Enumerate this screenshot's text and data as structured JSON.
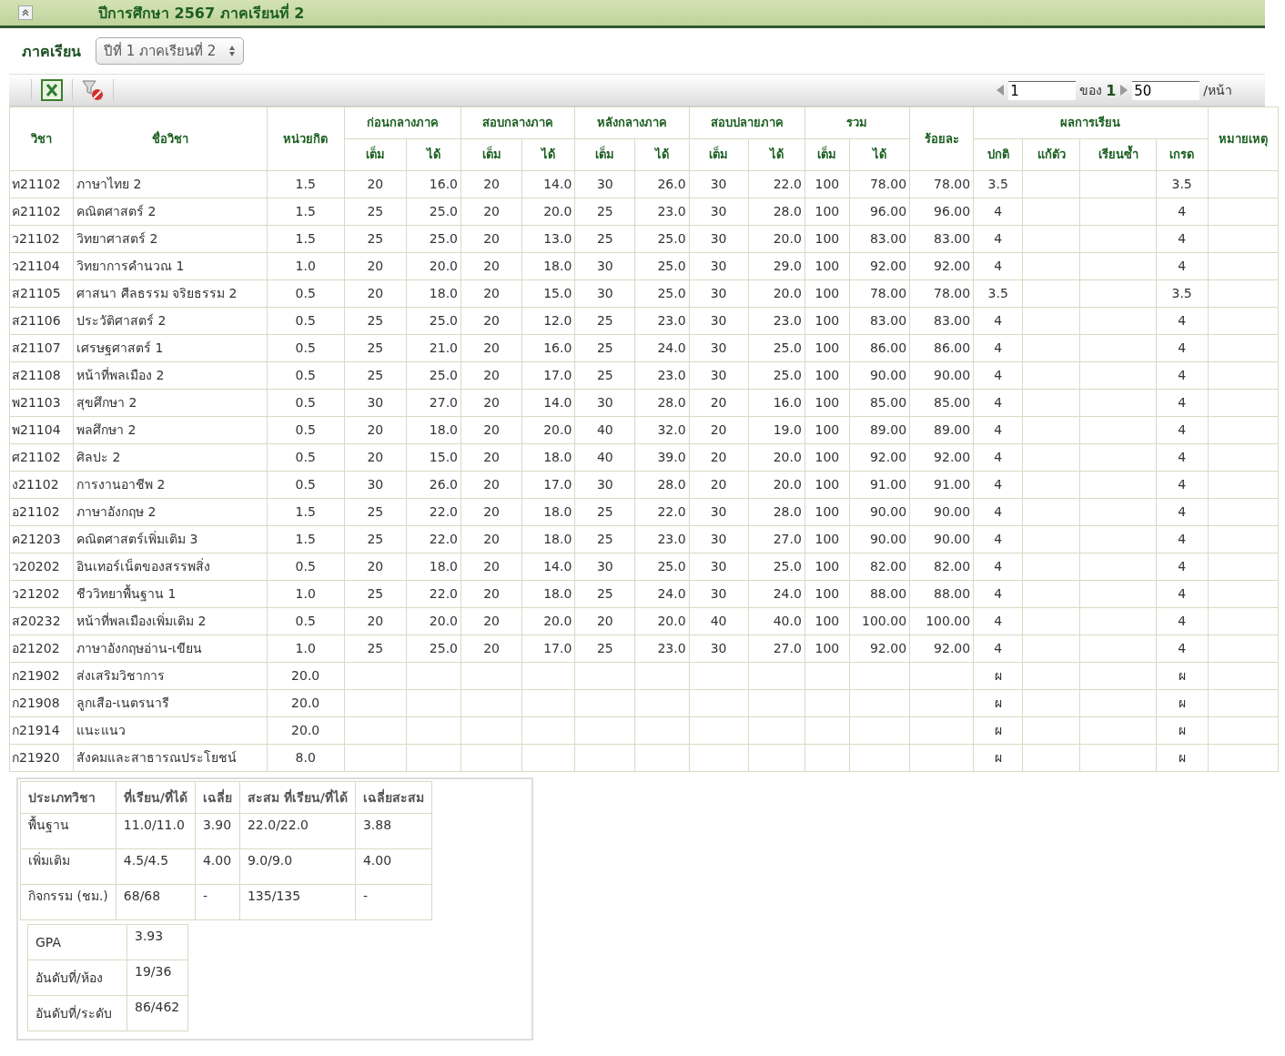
{
  "panel": {
    "title": "ปีการศึกษา 2567 ภาคเรียนที่ 2",
    "collapsed": false
  },
  "term_filter": {
    "label": "ภาคเรียน",
    "value": "ปีที่ 1 ภาคเรียนที่ 2"
  },
  "pager": {
    "page": "1",
    "of_label": "ของ",
    "total_pages": "1",
    "page_size": "50",
    "per_page_label": "/หน้า"
  },
  "table": {
    "columns": {
      "code": "วิชา",
      "name": "ชื่อวิชา",
      "credits": "หน่วยกิต",
      "groups": [
        {
          "label": "ก่อนกลางภาค",
          "full": "เต็ม",
          "got": "ได้"
        },
        {
          "label": "สอบกลางภาค",
          "full": "เต็ม",
          "got": "ได้"
        },
        {
          "label": "หลังกลางภาค",
          "full": "เต็ม",
          "got": "ได้"
        },
        {
          "label": "สอบปลายภาค",
          "full": "เต็ม",
          "got": "ได้"
        },
        {
          "label": "รวม",
          "full": "เต็ม",
          "got": "ได้"
        }
      ],
      "percent": "ร้อยละ",
      "result": "ผลการเรียน",
      "result_sub": [
        "ปกติ",
        "แก้ตัว",
        "เรียนซ้ำ",
        "เกรด"
      ],
      "note": "หมายเหตุ"
    },
    "rows": [
      {
        "code": "ท21102",
        "name": "ภาษาไทย 2",
        "credits": "1.5",
        "scores": [
          "20",
          "16.0",
          "20",
          "14.0",
          "30",
          "26.0",
          "30",
          "22.0",
          "100",
          "78.00"
        ],
        "percent": "78.00",
        "normal": "3.5",
        "grade": "3.5"
      },
      {
        "code": "ค21102",
        "name": "คณิตศาสตร์ 2",
        "credits": "1.5",
        "scores": [
          "25",
          "25.0",
          "20",
          "20.0",
          "25",
          "23.0",
          "30",
          "28.0",
          "100",
          "96.00"
        ],
        "percent": "96.00",
        "normal": "4",
        "grade": "4"
      },
      {
        "code": "ว21102",
        "name": "วิทยาศาสตร์ 2",
        "credits": "1.5",
        "scores": [
          "25",
          "25.0",
          "20",
          "13.0",
          "25",
          "25.0",
          "30",
          "20.0",
          "100",
          "83.00"
        ],
        "percent": "83.00",
        "normal": "4",
        "grade": "4"
      },
      {
        "code": "ว21104",
        "name": "วิทยาการคำนวณ 1",
        "credits": "1.0",
        "scores": [
          "20",
          "20.0",
          "20",
          "18.0",
          "30",
          "25.0",
          "30",
          "29.0",
          "100",
          "92.00"
        ],
        "percent": "92.00",
        "normal": "4",
        "grade": "4"
      },
      {
        "code": "ส21105",
        "name": "ศาสนา ศีลธรรม จริยธรรม 2",
        "credits": "0.5",
        "scores": [
          "20",
          "18.0",
          "20",
          "15.0",
          "30",
          "25.0",
          "30",
          "20.0",
          "100",
          "78.00"
        ],
        "percent": "78.00",
        "normal": "3.5",
        "grade": "3.5"
      },
      {
        "code": "ส21106",
        "name": "ประวัติศาสตร์ 2",
        "credits": "0.5",
        "scores": [
          "25",
          "25.0",
          "20",
          "12.0",
          "25",
          "23.0",
          "30",
          "23.0",
          "100",
          "83.00"
        ],
        "percent": "83.00",
        "normal": "4",
        "grade": "4"
      },
      {
        "code": "ส21107",
        "name": "เศรษฐศาสตร์ 1",
        "credits": "0.5",
        "scores": [
          "25",
          "21.0",
          "20",
          "16.0",
          "25",
          "24.0",
          "30",
          "25.0",
          "100",
          "86.00"
        ],
        "percent": "86.00",
        "normal": "4",
        "grade": "4"
      },
      {
        "code": "ส21108",
        "name": "หน้าที่พลเมือง 2",
        "credits": "0.5",
        "scores": [
          "25",
          "25.0",
          "20",
          "17.0",
          "25",
          "23.0",
          "30",
          "25.0",
          "100",
          "90.00"
        ],
        "percent": "90.00",
        "normal": "4",
        "grade": "4"
      },
      {
        "code": "พ21103",
        "name": "สุขศึกษา 2",
        "credits": "0.5",
        "scores": [
          "30",
          "27.0",
          "20",
          "14.0",
          "30",
          "28.0",
          "20",
          "16.0",
          "100",
          "85.00"
        ],
        "percent": "85.00",
        "normal": "4",
        "grade": "4"
      },
      {
        "code": "พ21104",
        "name": "พลศึกษา 2",
        "credits": "0.5",
        "scores": [
          "20",
          "18.0",
          "20",
          "20.0",
          "40",
          "32.0",
          "20",
          "19.0",
          "100",
          "89.00"
        ],
        "percent": "89.00",
        "normal": "4",
        "grade": "4"
      },
      {
        "code": "ศ21102",
        "name": "ศิลปะ 2",
        "credits": "0.5",
        "scores": [
          "20",
          "15.0",
          "20",
          "18.0",
          "40",
          "39.0",
          "20",
          "20.0",
          "100",
          "92.00"
        ],
        "percent": "92.00",
        "normal": "4",
        "grade": "4"
      },
      {
        "code": "ง21102",
        "name": "การงานอาชีพ 2",
        "credits": "0.5",
        "scores": [
          "30",
          "26.0",
          "20",
          "17.0",
          "30",
          "28.0",
          "20",
          "20.0",
          "100",
          "91.00"
        ],
        "percent": "91.00",
        "normal": "4",
        "grade": "4"
      },
      {
        "code": "อ21102",
        "name": "ภาษาอังกฤษ 2",
        "credits": "1.5",
        "scores": [
          "25",
          "22.0",
          "20",
          "18.0",
          "25",
          "22.0",
          "30",
          "28.0",
          "100",
          "90.00"
        ],
        "percent": "90.00",
        "normal": "4",
        "grade": "4"
      },
      {
        "code": "ค21203",
        "name": "คณิตศาสตร์เพิ่มเติม 3",
        "credits": "1.5",
        "scores": [
          "25",
          "22.0",
          "20",
          "18.0",
          "25",
          "23.0",
          "30",
          "27.0",
          "100",
          "90.00"
        ],
        "percent": "90.00",
        "normal": "4",
        "grade": "4"
      },
      {
        "code": "ว20202",
        "name": "อินเทอร์เน็ตของสรรพสิ่ง",
        "credits": "0.5",
        "scores": [
          "20",
          "18.0",
          "20",
          "14.0",
          "30",
          "25.0",
          "30",
          "25.0",
          "100",
          "82.00"
        ],
        "percent": "82.00",
        "normal": "4",
        "grade": "4"
      },
      {
        "code": "ว21202",
        "name": "ชีววิทยาพื้นฐาน 1",
        "credits": "1.0",
        "scores": [
          "25",
          "22.0",
          "20",
          "18.0",
          "25",
          "24.0",
          "30",
          "24.0",
          "100",
          "88.00"
        ],
        "percent": "88.00",
        "normal": "4",
        "grade": "4"
      },
      {
        "code": "ส20232",
        "name": "หน้าที่พลเมืองเพิ่มเติม 2",
        "credits": "0.5",
        "scores": [
          "20",
          "20.0",
          "20",
          "20.0",
          "20",
          "20.0",
          "40",
          "40.0",
          "100",
          "100.00"
        ],
        "percent": "100.00",
        "normal": "4",
        "grade": "4"
      },
      {
        "code": "อ21202",
        "name": "ภาษาอังกฤษอ่าน-เขียน",
        "credits": "1.0",
        "scores": [
          "25",
          "25.0",
          "20",
          "17.0",
          "25",
          "23.0",
          "30",
          "27.0",
          "100",
          "92.00"
        ],
        "percent": "92.00",
        "normal": "4",
        "grade": "4"
      },
      {
        "code": "ก21902",
        "name": "ส่งเสริมวิชาการ",
        "credits": "20.0",
        "normal": "ผ",
        "grade": "ผ"
      },
      {
        "code": "ก21908",
        "name": "ลูกเสือ-เนตรนารี",
        "credits": "20.0",
        "normal": "ผ",
        "grade": "ผ"
      },
      {
        "code": "ก21914",
        "name": "แนะแนว",
        "credits": "20.0",
        "normal": "ผ",
        "grade": "ผ"
      },
      {
        "code": "ก21920",
        "name": "สังคมและสาธารณประโยชน์",
        "credits": "8.0",
        "normal": "ผ",
        "grade": "ผ"
      }
    ]
  },
  "summary": {
    "columns": [
      "ประเภทวิชา",
      "ที่เรียน/ที่ได้",
      "เฉลี่ย",
      "สะสม ที่เรียน/ที่ได้",
      "เฉลี่ยสะสม"
    ],
    "rows": [
      [
        "พื้นฐาน",
        "11.0/11.0",
        "3.90",
        "22.0/22.0",
        "3.88"
      ],
      [
        "เพิ่มเติม",
        "4.5/4.5",
        "4.00",
        "9.0/9.0",
        "4.00"
      ],
      [
        "กิจกรรม (ชม.)",
        "68/68",
        "-",
        "135/135",
        "-"
      ]
    ],
    "stats": [
      {
        "label": "GPA",
        "value": "3.93"
      },
      {
        "label": "อันดับที่/ห้อง",
        "value": "19/36"
      },
      {
        "label": "อันดับที่/ระดับ",
        "value": "86/462"
      }
    ]
  }
}
